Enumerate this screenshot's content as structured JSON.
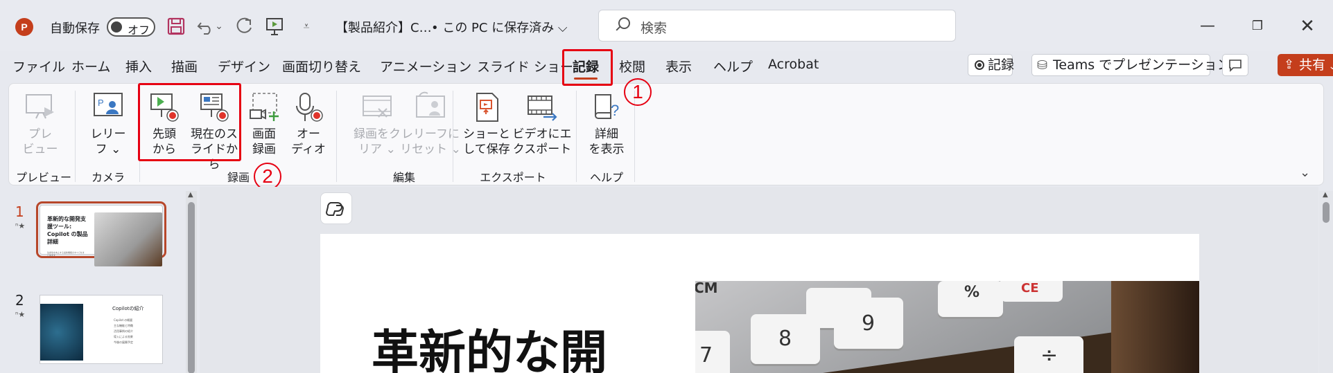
{
  "app": {
    "autosave_label": "自動保存",
    "autosave_state": "オフ",
    "doc_name": "【製品紹介】C…",
    "save_state": "• この PC に保存済み ⌵",
    "search_placeholder": "検索"
  },
  "tabs": [
    "ファイル",
    "ホーム",
    "挿入",
    "描画",
    "デザイン",
    "画面切り替え",
    "アニメーション",
    "スライド ショー",
    "記録",
    "校閲",
    "表示",
    "ヘルプ",
    "Acrobat"
  ],
  "right_buttons": {
    "record": "記録",
    "teams": "Teams でプレゼンテーション",
    "share": "共有"
  },
  "ribbon": {
    "preview": {
      "label": "プレ\nビュー",
      "group": "プレビュー"
    },
    "camera": {
      "label": "レリー\nフ ⌄",
      "group": "カメラ"
    },
    "record": {
      "from_start": "先頭\nから",
      "from_current": "現在のス\nライドから",
      "screen": "画面\n録画",
      "audio": "オー\nディオ",
      "group": "録画"
    },
    "edit": {
      "clear": "録画をク\nリア ⌄",
      "reset": "レリーフに\nリセット ⌄",
      "group": "編集"
    },
    "export": {
      "save_show": "ショーと\nして保存",
      "export_video": "ビデオにエ\nクスポート",
      "group": "エクスポート"
    },
    "help": {
      "details": "詳細\nを表示",
      "group": "ヘルプ"
    }
  },
  "annotations": {
    "one": "1",
    "two": "2"
  },
  "slides": [
    {
      "num": "1",
      "title": "革新的な開発支援ツール: Copilot の製品詳細",
      "sub": "生産性を向上する最新機能のすべてをまとめます"
    },
    {
      "num": "2",
      "title": "Copilotの紹介",
      "bullets": [
        "Copilot の概要",
        "主な機能と特徴",
        "活用事例の紹介",
        "導入による効果",
        "今後の展開予定"
      ]
    }
  ],
  "main_slide": {
    "title": "革新的な開"
  },
  "keys": [
    "CM",
    "%",
    "8",
    "9",
    "7",
    "÷",
    "CE"
  ],
  "colors": {
    "accent": "#c43e1c",
    "annotation": "#e60012"
  }
}
